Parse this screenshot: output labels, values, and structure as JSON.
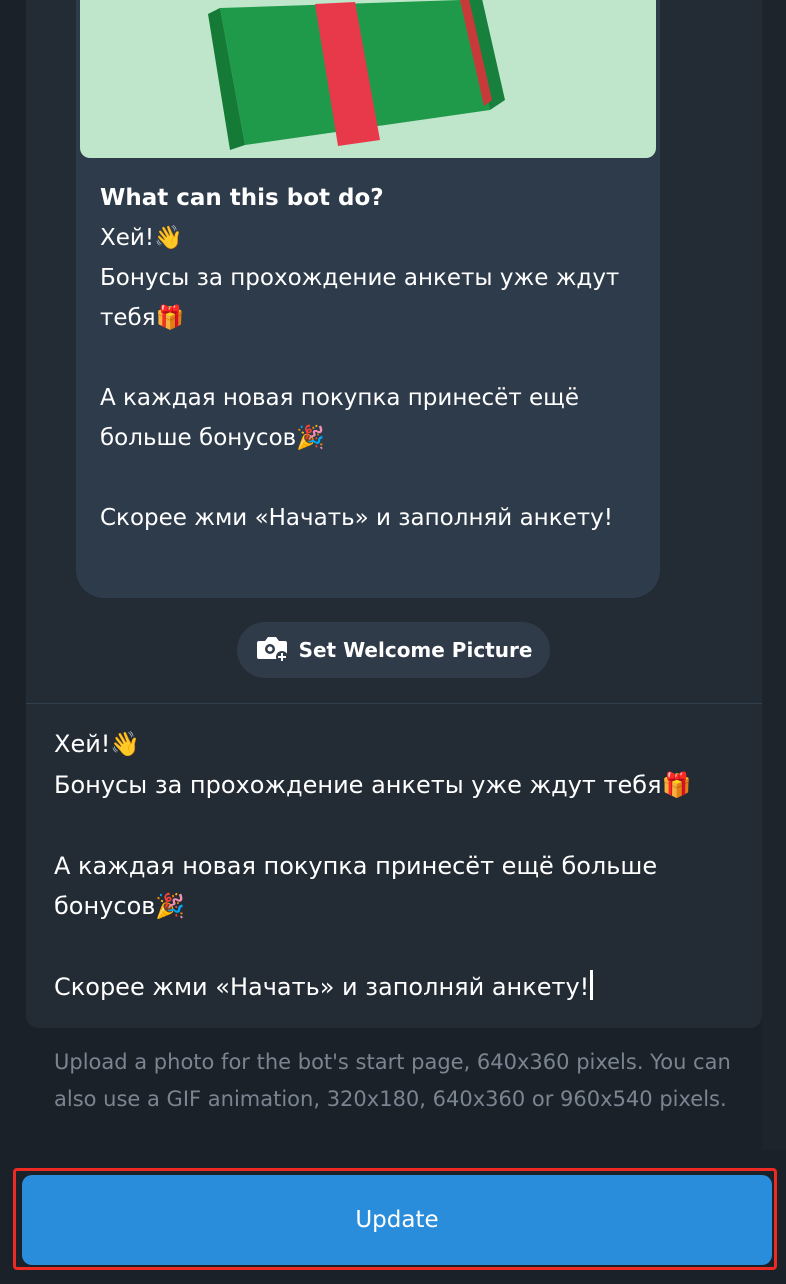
{
  "preview": {
    "title": "What can this bot do?",
    "message": "Хей!👋\nБонусы за прохождение анкеты уже ждут тебя🎁\n\nА каждая новая покупка принесёт ещё больше бонусов🎉\n\nСкорее жми «Начать» и заполняй анкету!"
  },
  "welcome_picture_button": {
    "label": "Set Welcome Picture",
    "icon": "camera-add-icon"
  },
  "editor": {
    "text": "Хей!👋\nБонусы за прохождение анкеты уже ждут тебя🎁\n\nА каждая новая покупка принесёт ещё больше бонусов🎉\n\nСкорее жми «Начать» и заполняй анкету!"
  },
  "hint": "Upload a photo for the bot's start page, 640x360 pixels. You can also use a GIF animation, 320x180, 640x360 or 960x540 pixels.",
  "update_button": {
    "label": "Update"
  },
  "colors": {
    "background": "#1b2128",
    "bubble": "#2e3b4a",
    "accent": "#2a8ddb",
    "highlight": "#ee2a24",
    "picture_bg": "#bfe5cb"
  }
}
